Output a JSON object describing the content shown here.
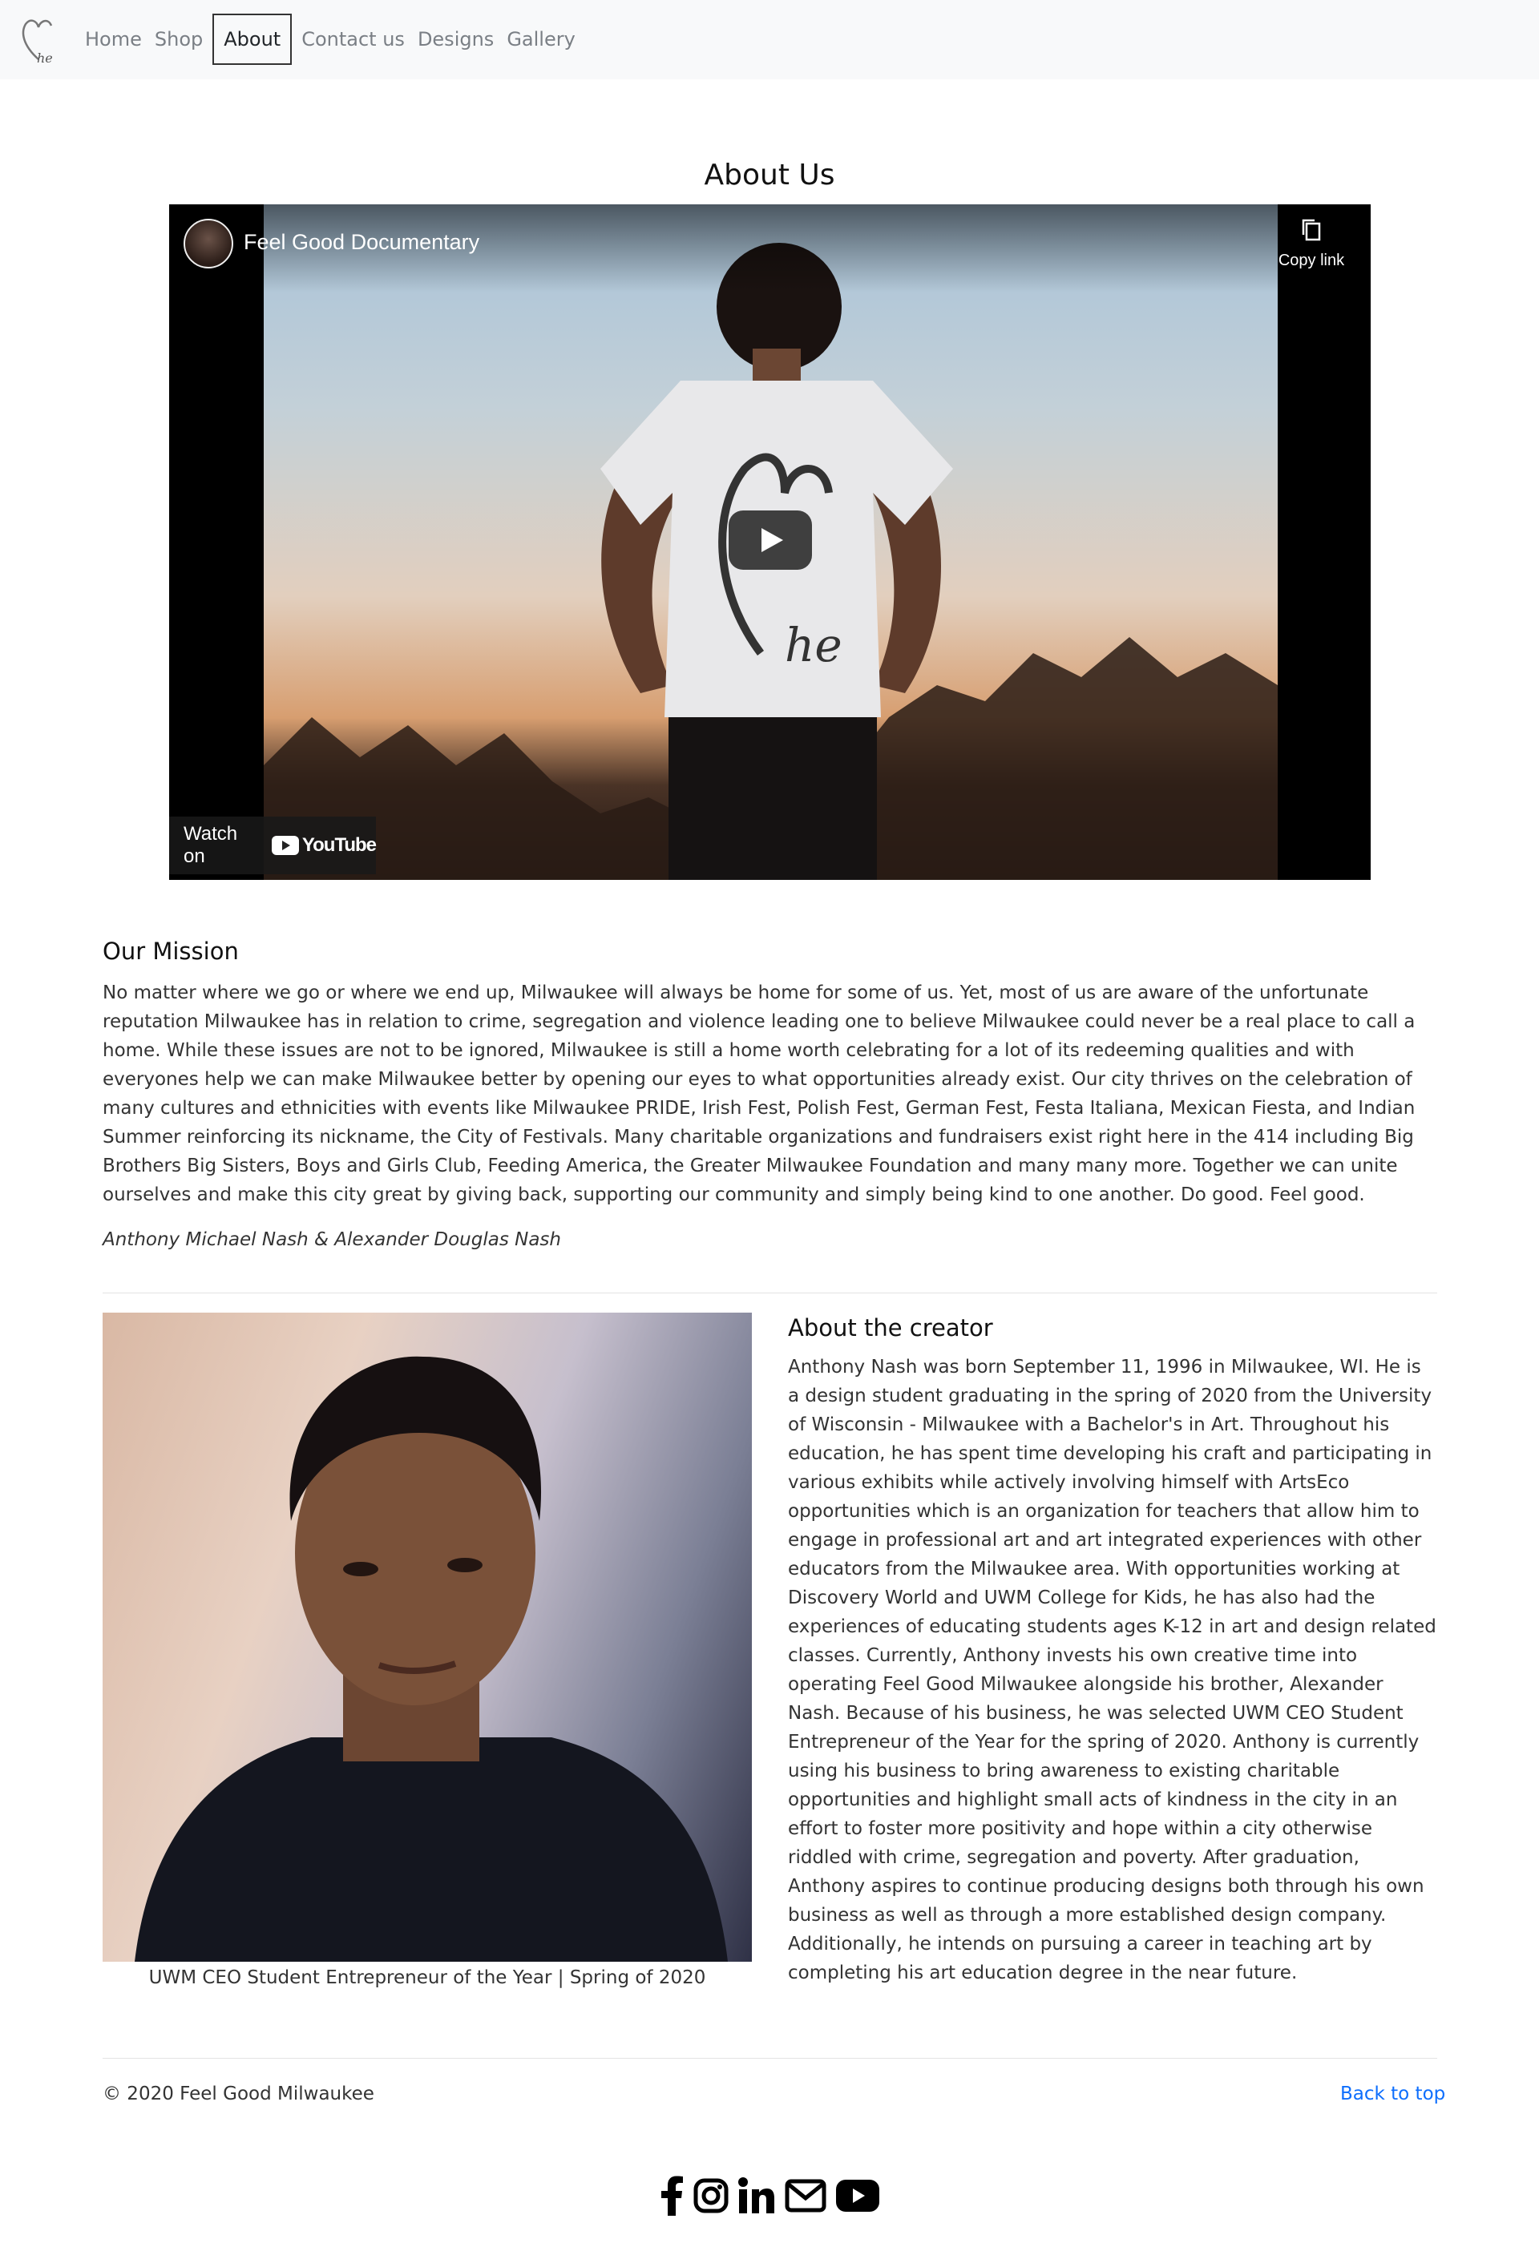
{
  "navbar": {
    "logo_text": "he",
    "items": [
      {
        "label": "Home"
      },
      {
        "label": "Shop"
      },
      {
        "label": "About"
      },
      {
        "label": "Contact us"
      },
      {
        "label": "Designs"
      },
      {
        "label": "Gallery"
      }
    ],
    "active": "About"
  },
  "page_title": "About Us",
  "video": {
    "title": "Feel Good Documentary",
    "copy_link_label": "Copy link",
    "watch_on_label": "Watch on",
    "platform": "YouTube",
    "shirt_logo_text": "he"
  },
  "mission": {
    "heading": "Our Mission",
    "body": "No matter where we go or where we end up, Milwaukee will always be home for some of us. Yet, most of us are aware of the unfortunate reputation Milwaukee has in relation to crime, segregation and violence leading one to believe Milwaukee could never be a real place to call a home. While these issues are not to be ignored, Milwaukee is still a home worth celebrating for a lot of its redeeming qualities and with everyones help we can make Milwaukee better by opening our eyes to what opportunities already exist. Our city thrives on the celebration of many cultures and ethnicities with events like Milwaukee PRIDE, Irish Fest, Polish Fest, German Fest, Festa Italiana, Mexican Fiesta, and Indian Summer reinforcing its nickname, the City of Festivals. Many charitable organizations and fundraisers exist right here in the 414 including Big Brothers Big Sisters, Boys and Girls Club, Feeding America, the Greater Milwaukee Foundation and many many more. Together we can unite ourselves and make this city great by giving back, supporting our community and simply being kind to one another. Do good. Feel good.",
    "signature": "Anthony Michael Nash & Alexander Douglas Nash"
  },
  "creator": {
    "photo_caption": "UWM CEO Student Entrepreneur of the Year | Spring of 2020",
    "heading": "About the creator",
    "body": "Anthony Nash was born September 11, 1996 in Milwaukee, WI. He is a design student graduating in the spring of 2020 from the University of Wisconsin - Milwaukee with a Bachelor's in Art. Throughout his education, he has spent time developing his craft and participating in various exhibits while actively involving himself with ArtsEco opportunities which is an organization for teachers that allow him to engage in professional art and art integrated experiences with other educators from the Milwaukee area. With opportunities working at Discovery World and UWM College for Kids, he has also had the experiences of educating students ages K-12 in art and design related classes. Currently, Anthony invests his own creative time into operating Feel Good Milwaukee alongside his brother, Alexander Nash. Because of his business, he was selected UWM CEO Student Entrepreneur of the Year for the spring of 2020. Anthony is currently using his business to bring awareness to existing charitable opportunities and highlight small acts of kindness in the city in an effort to foster more positivity and hope within a city otherwise riddled with crime, segregation and poverty. After graduation, Anthony aspires to continue producing designs both through his own business as well as through a more established design company. Additionally, he intends on pursuing a career in teaching art by completing his art education degree in the near future."
  },
  "footer": {
    "copyright": "© 2020 Feel Good Milwaukee",
    "back_to_top": "Back to top",
    "socials": [
      "facebook-icon",
      "instagram-icon",
      "linkedin-icon",
      "mail-icon",
      "youtube-icon"
    ]
  },
  "colors": {
    "navbar_bg": "#f8f9fa",
    "link": "#0d6efd",
    "text": "#212529",
    "youtube_red": "#ff0000"
  }
}
